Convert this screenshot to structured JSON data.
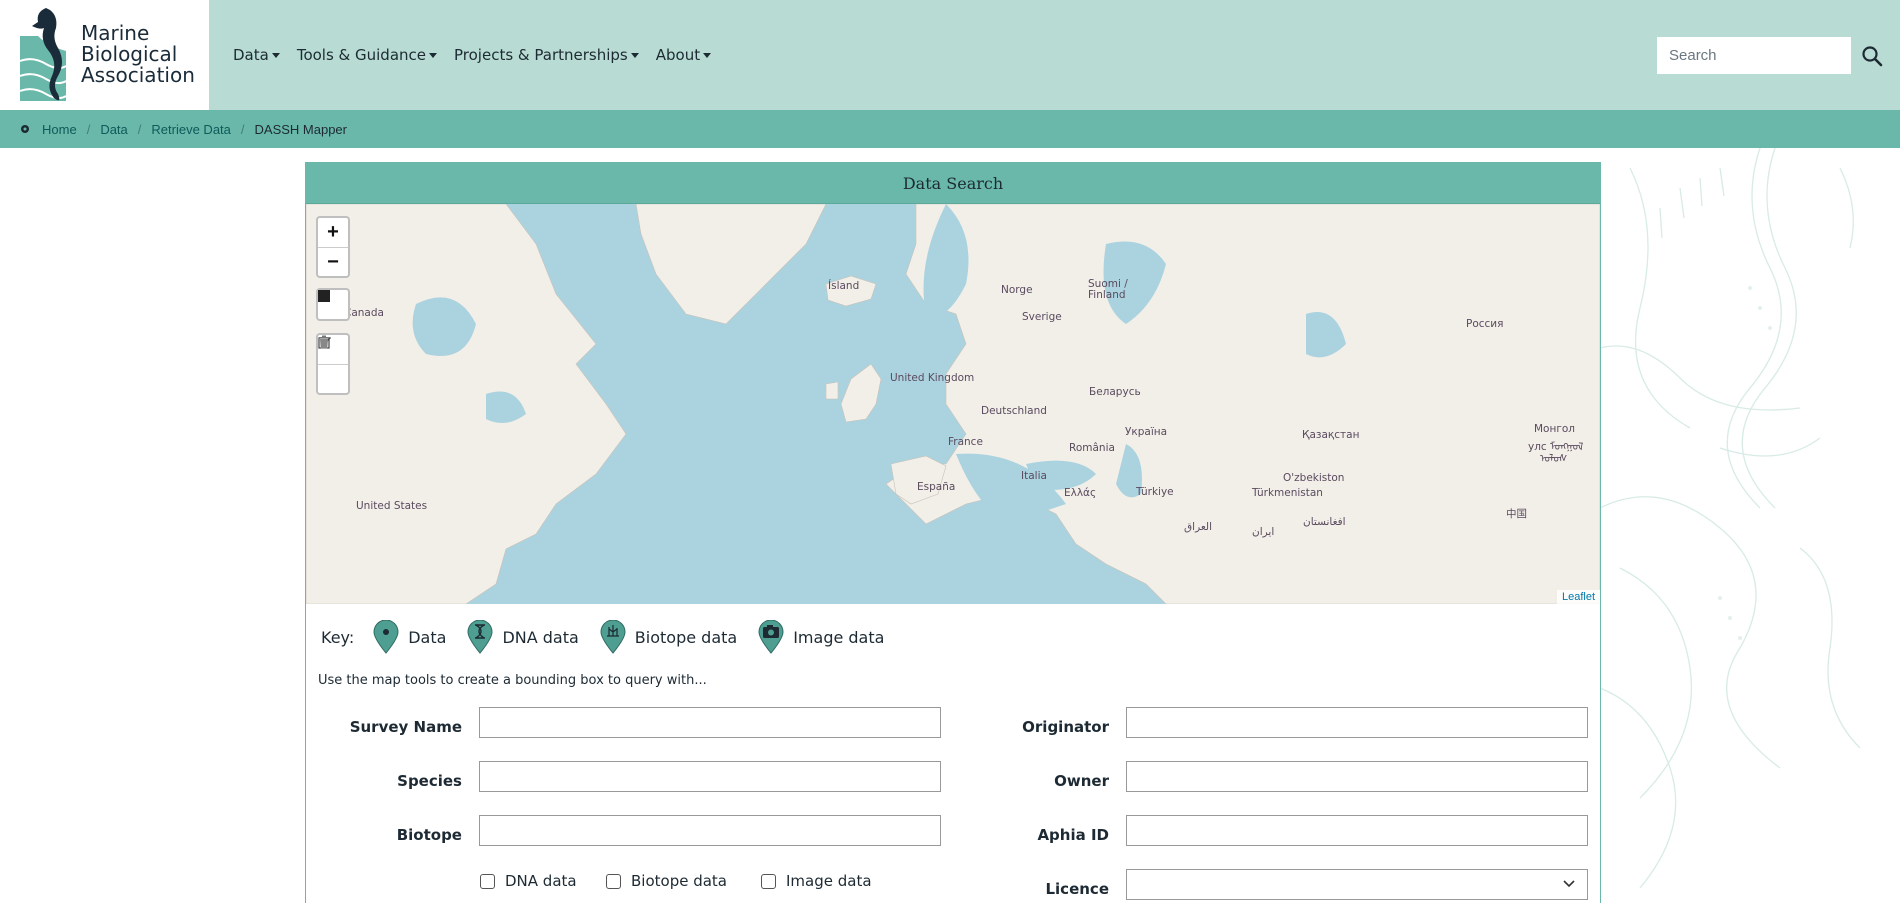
{
  "logo": {
    "lines": [
      "Marine",
      "Biological",
      "Association"
    ]
  },
  "nav": {
    "items": [
      {
        "label": "Data"
      },
      {
        "label": "Tools & Guidance"
      },
      {
        "label": "Projects & Partnerships"
      },
      {
        "label": "About"
      }
    ]
  },
  "search": {
    "placeholder": "Search"
  },
  "breadcrumb": {
    "items": [
      "Home",
      "Data",
      "Retrieve Data"
    ],
    "current": "DASSH Mapper"
  },
  "panel": {
    "title": "Data Search"
  },
  "map": {
    "labels": [
      "Canada",
      "Ísland",
      "Norge",
      "Suomi /",
      "Finland",
      "Sverige",
      "Россия",
      "United Kingdom",
      "Беларусь",
      "Deutschland",
      "Україна",
      "Қазақстан",
      "Монгол",
      "улс ᠮᠣᠩᠭᠣᠯ",
      "ᠤᠯᠤᠰ",
      "France",
      "România",
      "O'zbekiston",
      "Italia",
      "España",
      "Ελλάς",
      "Türkiye",
      "Türkmenistan",
      "United States",
      "中国",
      "العراق",
      "ایران",
      "افغانستان"
    ],
    "attribution": "Leaflet",
    "zoom_in": "+",
    "zoom_out": "−"
  },
  "key": {
    "title": "Key:",
    "items": [
      "Data",
      "DNA data",
      "Biotope data",
      "Image data"
    ]
  },
  "hint": "Use the map tools to create a bounding box to query with...",
  "form": {
    "survey_name": "Survey Name",
    "species": "Species",
    "biotope": "Biotope",
    "originator": "Originator",
    "owner": "Owner",
    "aphia_id": "Aphia ID",
    "licence": "Licence",
    "checks": [
      "DNA data",
      "Biotope data",
      "Image data"
    ]
  },
  "colors": {
    "header_bg": "#b8dcd3",
    "accent": "#69b8a9",
    "map_water": "#abd3df",
    "map_land": "#f2efe9"
  }
}
